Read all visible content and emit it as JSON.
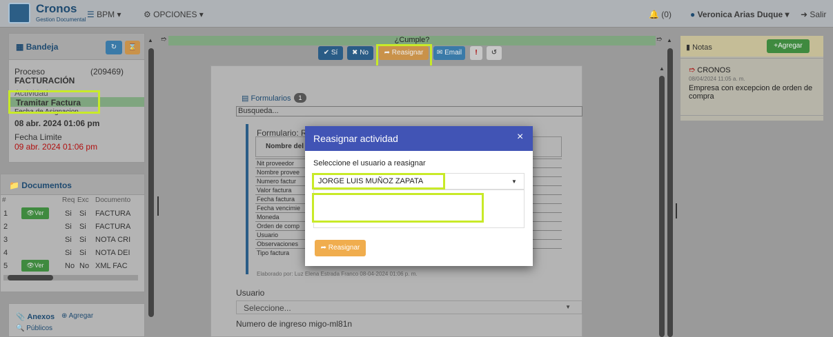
{
  "topbar": {
    "app_name": "Cronos",
    "app_subtitle": "Gestion Documental",
    "menu_bpm": "BPM",
    "menu_opciones": "OPCIONES",
    "notifications_count": "(0)",
    "user_name": "Veronica Arias Duque",
    "logout_label": "Salir"
  },
  "bandeja": {
    "title": "Bandeja",
    "proceso_label": "Proceso",
    "proceso_id": "(209469)",
    "proceso_name": "FACTURACIÓN",
    "actividad_label": "Actividad",
    "actividad_value": "Tramitar Factura",
    "fecha_asignacion_label": "Fecha de Asignacion",
    "fecha_asignacion_value": "08 abr. 2024 01:06 pm",
    "fecha_limite_label": "Fecha Limite",
    "fecha_limite_value": "09 abr. 2024 01:06 pm"
  },
  "documentos": {
    "title": "Documentos",
    "headers": [
      "#",
      "",
      "Req",
      "Exc",
      "Documento"
    ],
    "view_label": "Ver",
    "rows": [
      {
        "num": "1",
        "has_view": true,
        "req": "Si",
        "exc": "Si",
        "doc": "FACTURA"
      },
      {
        "num": "2",
        "has_view": false,
        "req": "Si",
        "exc": "Si",
        "doc": "FACTURA"
      },
      {
        "num": "3",
        "has_view": false,
        "req": "Si",
        "exc": "Si",
        "doc": "NOTA CRI"
      },
      {
        "num": "4",
        "has_view": false,
        "req": "Si",
        "exc": "Si",
        "doc": "NOTA DEI"
      },
      {
        "num": "5",
        "has_view": true,
        "req": "No",
        "exc": "No",
        "doc": "XML FAC"
      }
    ]
  },
  "anexos": {
    "title": "Anexos",
    "agregar_label": "Agregar",
    "publicos_label": "Públicos"
  },
  "center": {
    "cumple_label": "¿Cumple?",
    "btn_si": "Sí",
    "btn_no": "No",
    "btn_reasignar": "Reasignar",
    "btn_email": "Email",
    "btn_alert": "!",
    "formularios_label": "Formularios",
    "formularios_count": "1",
    "search_placeholder": "Busqueda...",
    "form_title": "Formulario: R",
    "form_col_header": "Nombre del",
    "form_fields": [
      "Nit proveedor",
      "Nombre provee",
      "Numero factur",
      "Valor factura",
      "Fecha factura",
      "Fecha vencimie",
      "Moneda",
      "Orden de comp",
      "Usuario",
      "Observaciones",
      "Tipo factura"
    ],
    "elaborado": "Elaborado por: Luz Elena Estrada Franco 08-04-2024 01:06 p. m.",
    "usuario_label": "Usuario",
    "usuario_select": "Seleccione...",
    "numero_ingreso_label": "Numero de ingreso migo-ml81n"
  },
  "notas": {
    "title": "Notas",
    "agregar_label": "Agregar",
    "note_author": "CRONOS",
    "note_date": "08/04/2024 11:05 a. m.",
    "note_text": "Empresa con excepcion de orden de compra"
  },
  "modal": {
    "title": "Reasignar actividad",
    "close": "×",
    "select_label": "Seleccione el usuario a reasignar",
    "selected_user": "JORGE LUIS MUÑOZ ZAPATA",
    "search_value": "",
    "submit_label": "Reasignar"
  },
  "colors": {
    "highlight": "#c8ea28",
    "modal_header": "#4154b5",
    "orange": "#f0ad4e",
    "green": "#5cb85c"
  }
}
